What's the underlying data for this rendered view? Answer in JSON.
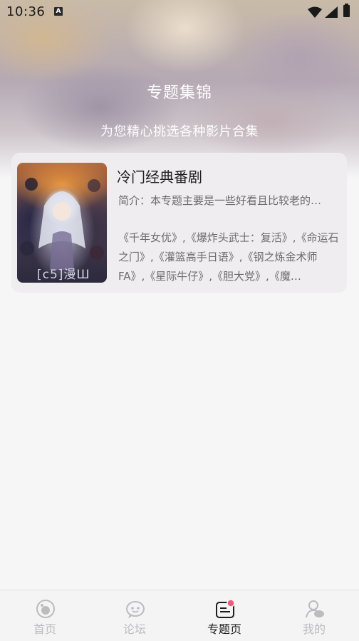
{
  "status_bar": {
    "time": "10:36",
    "notification_icon": "a-icon"
  },
  "header": {
    "title": "专题集锦",
    "subtitle": "为您精心挑选各种影片合集"
  },
  "topics": [
    {
      "title": "冷门经典番剧",
      "intro": "简介：本专题主要是一些好看且比较老的…",
      "list": "《千年女优》,《爆炸头武士：复活》,《命运石之门》,《灌篮高手日语》,《钢之炼金术师FA》,《星际牛仔》,《胆大党》,《魔…",
      "cover_caption": "[c5]漫Ш"
    }
  ],
  "tabbar": {
    "items": [
      {
        "label": "首页",
        "icon": "home-icon",
        "active": false
      },
      {
        "label": "论坛",
        "icon": "forum-icon",
        "active": false
      },
      {
        "label": "专题页",
        "icon": "topic-icon",
        "active": true
      },
      {
        "label": "我的",
        "icon": "profile-icon",
        "active": false
      }
    ]
  },
  "colors": {
    "accent": "#ee5a7a",
    "active_text": "#1e1e1e",
    "inactive_text": "#bcbcbf"
  }
}
